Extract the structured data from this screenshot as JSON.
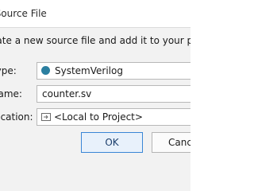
{
  "window": {
    "title": "Create Source File"
  },
  "instruction": "Create a new source file and add it to your project.",
  "form": {
    "file_type_label": "File type:",
    "file_type_value": "SystemVerilog",
    "file_name_label": "File name:",
    "file_name_value": "counter.sv",
    "file_location_label": "File location:",
    "file_location_value": "<Local to Project>"
  },
  "buttons": {
    "ok_label": "OK",
    "cancel_label": "Cancel"
  },
  "colors": {
    "file_type_icon": "#2b7fa0",
    "ok_border": "#3a86d6"
  }
}
